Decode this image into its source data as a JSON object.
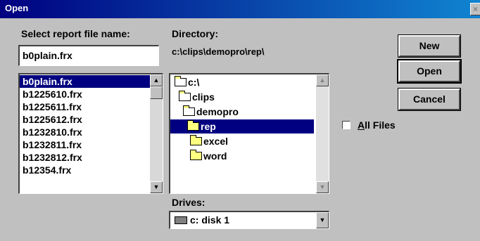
{
  "window": {
    "title": "Open",
    "close": "×"
  },
  "file": {
    "label": "Select report file name:",
    "value": "b0plain.frx",
    "items": [
      "b0plain.frx",
      "b1225610.frx",
      "b1225611.frx",
      "b1225612.frx",
      "b1232810.frx",
      "b1232811.frx",
      "b1232812.frx",
      "b12354.frx"
    ]
  },
  "directory": {
    "label": "Directory:",
    "path": "c:\\clips\\demopro\\rep\\",
    "items": [
      "c:\\",
      "clips",
      "demopro",
      "rep",
      "excel",
      "word"
    ]
  },
  "drives": {
    "label": "Drives:",
    "value": "c: disk 1"
  },
  "buttons": {
    "new": "New",
    "open": "Open",
    "cancel": "Cancel"
  },
  "all_files": {
    "label_ul": "A",
    "label_rest": "ll Files",
    "checked": false
  },
  "icons": {
    "scroll_up": "▲",
    "scroll_down": "▼",
    "dropdown": "▼",
    "drive": "drive-icon",
    "folder": "folder-icon"
  }
}
